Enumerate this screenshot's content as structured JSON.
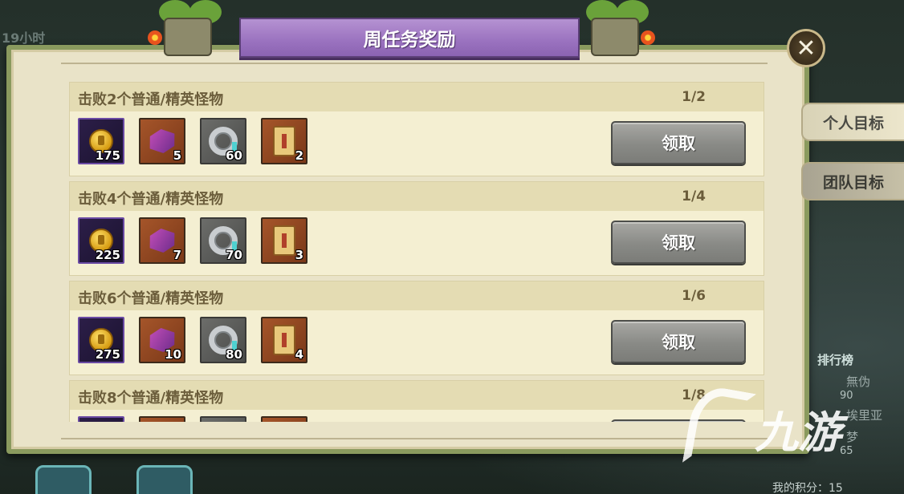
{
  "background": {
    "timer_text": "19小时",
    "rank_title": "排行榜",
    "rank_entries": [
      {
        "name": "無伪",
        "score": "90"
      },
      {
        "name": "埃里亚",
        "score": ""
      },
      {
        "name": "梦",
        "score": "65"
      }
    ],
    "my_score": "我的积分：15"
  },
  "dialog": {
    "title": "周任务奖励",
    "close_label": "✕",
    "tabs": [
      {
        "label": "个人目标",
        "active": true
      },
      {
        "label": "团队目标",
        "active": false
      }
    ],
    "tasks": [
      {
        "title": "击败2个普通/精英怪物",
        "progress": "1/2",
        "rewards": [
          {
            "icon": "trophy-coin-icon",
            "qty": "175"
          },
          {
            "icon": "purple-ore-icon",
            "qty": "5"
          },
          {
            "icon": "silver-ring-icon",
            "qty": "60"
          },
          {
            "icon": "scroll-icon",
            "qty": "2"
          }
        ],
        "button": "领取"
      },
      {
        "title": "击败4个普通/精英怪物",
        "progress": "1/4",
        "rewards": [
          {
            "icon": "trophy-coin-icon",
            "qty": "225"
          },
          {
            "icon": "purple-ore-icon",
            "qty": "7"
          },
          {
            "icon": "silver-ring-icon",
            "qty": "70"
          },
          {
            "icon": "scroll-icon",
            "qty": "3"
          }
        ],
        "button": "领取"
      },
      {
        "title": "击败6个普通/精英怪物",
        "progress": "1/6",
        "rewards": [
          {
            "icon": "trophy-coin-icon",
            "qty": "275"
          },
          {
            "icon": "purple-ore-icon",
            "qty": "10"
          },
          {
            "icon": "silver-ring-icon",
            "qty": "80"
          },
          {
            "icon": "scroll-icon",
            "qty": "4"
          }
        ],
        "button": "领取"
      },
      {
        "title": "击败8个普通/精英怪物",
        "progress": "1/8",
        "rewards": [
          {
            "icon": "trophy-coin-icon",
            "qty": ""
          },
          {
            "icon": "purple-ore-icon",
            "qty": ""
          },
          {
            "icon": "silver-ring-icon",
            "qty": ""
          },
          {
            "icon": "scroll-icon",
            "qty": ""
          }
        ],
        "button": ""
      }
    ]
  },
  "watermark": {
    "text": "九游"
  },
  "colors": {
    "banner": "#9a72bf",
    "panel": "#e9e3c8",
    "button": "#898a86",
    "title_text": "#6b5d3b"
  }
}
